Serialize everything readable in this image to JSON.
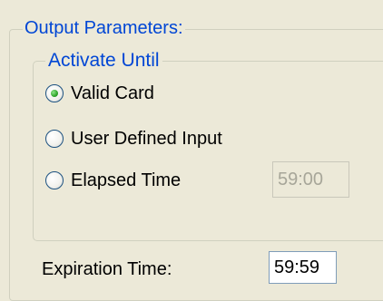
{
  "output_parameters": {
    "title": "Output Parameters:",
    "activate_until": {
      "title": "Activate Until",
      "options": [
        {
          "label": "Valid Card",
          "selected": true
        },
        {
          "label": "User Defined Input",
          "selected": false
        },
        {
          "label": "Elapsed Time",
          "selected": false
        }
      ],
      "elapsed_time_value": "59:00"
    },
    "expiration_time": {
      "label": "Expiration Time:",
      "value": "59:59"
    }
  },
  "colors": {
    "background": "#ece9d8",
    "group_title": "#0046d5",
    "radio_selected_dot": "#2fa52a"
  }
}
